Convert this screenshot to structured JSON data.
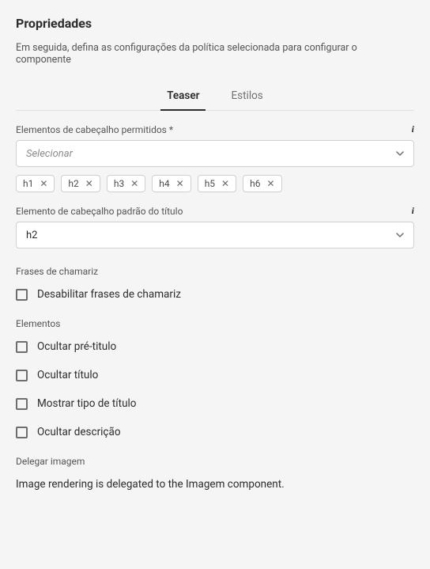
{
  "header": {
    "title": "Propriedades",
    "subtitle": "Em seguida, defina as configurações da política selecionada para configurar o componente"
  },
  "tabs": {
    "items": [
      {
        "label": "Teaser",
        "active": true
      },
      {
        "label": "Estilos",
        "active": false
      }
    ]
  },
  "allowed_header": {
    "label": "Elementos de cabeçalho permitidos *",
    "placeholder": "Selecionar",
    "tags": [
      "h1",
      "h2",
      "h3",
      "h4",
      "h5",
      "h6"
    ]
  },
  "default_header": {
    "label": "Elemento de cabeçalho padrão do título",
    "value": "h2"
  },
  "cta_section": {
    "label": "Frases de chamariz",
    "checkbox": {
      "label": "Desabilitar frases de chamariz"
    }
  },
  "elements_section": {
    "label": "Elementos",
    "checkboxes": [
      {
        "label": "Ocultar pré-titulo"
      },
      {
        "label": "Ocultar título"
      },
      {
        "label": "Mostrar tipo de título"
      },
      {
        "label": "Ocultar descrição"
      }
    ]
  },
  "delegate_section": {
    "label": "Delegar imagem",
    "text": "Image rendering is delegated to the Imagem component."
  }
}
